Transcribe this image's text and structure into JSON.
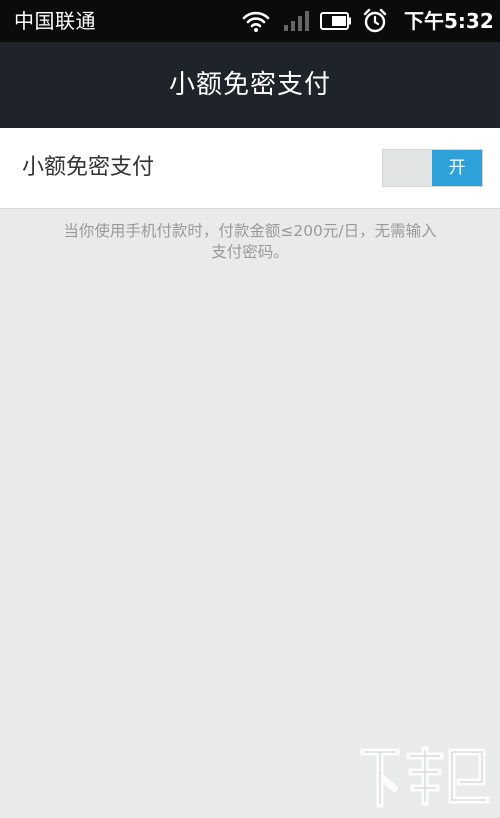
{
  "status_bar": {
    "carrier": "中国联通",
    "time": "下午5:32",
    "icons": [
      "wifi-icon",
      "signal-icon",
      "battery-icon",
      "alarm-icon"
    ]
  },
  "header": {
    "title": "小额免密支付"
  },
  "setting": {
    "label": "小额免密支付",
    "toggle_label": "开",
    "toggle_state": "on"
  },
  "description": {
    "line1": "当你使用手机付款时，付款金额≤200元/日，无需输入",
    "line2": "支付密码。"
  },
  "colors": {
    "status_bar": "#0b0b0b",
    "title_bar": "#1f242a",
    "background": "#e9eaea",
    "toggle_on": "#2ea1d9",
    "description_text": "#9a9a9a"
  }
}
